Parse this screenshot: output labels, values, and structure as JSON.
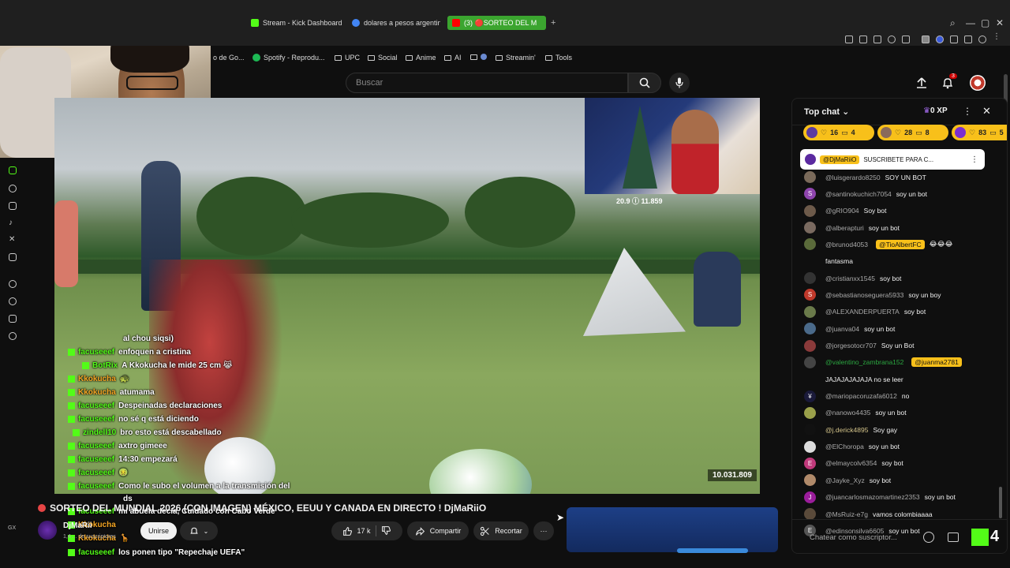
{
  "browser": {
    "tabs": [
      {
        "label": "Stream - Kick Dashboard",
        "icon": "kick-icon",
        "color": "#53fc18"
      },
      {
        "label": "dolares a pesos argentino",
        "icon": "google-icon",
        "color": "#4285f4"
      },
      {
        "label": "(3) 🔴SORTEO DEL M",
        "icon": "youtube-icon",
        "color": "#ff0000"
      }
    ],
    "new_tab": "+",
    "window_controls": [
      "—",
      "▢",
      "✕"
    ]
  },
  "bookmarks": [
    {
      "label": "o de Go..."
    },
    {
      "label": "Spotify - Reprodu..."
    },
    {
      "label": "UPC"
    },
    {
      "label": "Social"
    },
    {
      "label": "Anime"
    },
    {
      "label": "AI"
    },
    {
      "label": ""
    },
    {
      "label": "Streamin'"
    },
    {
      "label": "Tools"
    }
  ],
  "youtube": {
    "search_placeholder": "Buscar",
    "notification_count": "3"
  },
  "video": {
    "viewer_overlay": "10.031.809",
    "overlay_stats": "20.9 ⓘ 11.859",
    "kick_chat": [
      {
        "user": "",
        "text": "al chou siqsi)"
      },
      {
        "user": "facuseeef",
        "text": "enfoquen a cristina"
      },
      {
        "user": "BotRix",
        "text": "A Kkokucha le mide 25 cm 😹"
      },
      {
        "user": "Kkokucha",
        "text": "🐢"
      },
      {
        "user": "Kkokucha",
        "text": "atumama"
      },
      {
        "user": "facuseeef",
        "text": "Despeinadas declaraciones"
      },
      {
        "user": "facuseeef",
        "text": "no sé q está diciendo"
      },
      {
        "user": "zindell10",
        "text": "bro esto está descabellado"
      },
      {
        "user": "facuseeef",
        "text": "axtro gimeee"
      },
      {
        "user": "facuseeef",
        "text": "14:30 empezará"
      },
      {
        "user": "facuseeef",
        "text": "🤢"
      },
      {
        "user": "facuseeef",
        "text": "Como le subo el volumen a la transmisión del"
      },
      {
        "user": "",
        "text": "ds"
      },
      {
        "user": "facuseeef",
        "text": "mi abuela decía, Cuidado con Cabo Verde"
      },
      {
        "user": "Kkokucha",
        "text": ""
      },
      {
        "user": "Kkokucha",
        "text": "🦒"
      },
      {
        "user": "facuseeef",
        "text": "los ponen tipo \"Repechaje UEFA\""
      }
    ]
  },
  "details": {
    "title": "SORTEO DEL MUNDIAL 2026 (CON IMAGEN) MÉXICO, EEUU Y CANADA EN DIRECTO ! DjMaRiiO",
    "channel_short": "DjMaRii",
    "subscribers": "1,4 ... de suscriptores",
    "join_label": "Unirse",
    "likes": "17 k",
    "share_label": "Compartir",
    "clip_label": "Recortar",
    "more_label": "···"
  },
  "chat": {
    "title": "Top chat",
    "xp": "0 XP",
    "tickers": [
      {
        "a": "16",
        "b": "4"
      },
      {
        "a": "28",
        "b": "8"
      },
      {
        "a": "83",
        "b": "5"
      }
    ],
    "pinned": {
      "user": "@DjMaRiiO",
      "text": "SUSCRIBETE PARA C..."
    },
    "messages": [
      {
        "user": "@luisgerardo8250",
        "text": "SOY UN BOT",
        "color": "#7a6a5a",
        "initial": ""
      },
      {
        "user": "@santinokuchich7054",
        "text": "soy un bot",
        "color": "#8e44ad",
        "initial": "S"
      },
      {
        "user": "@gRIO904",
        "text": "Soy bot",
        "color": "#6d5a4a",
        "initial": ""
      },
      {
        "user": "@alberapturi",
        "text": "soy un bot",
        "color": "#7a6a60",
        "initial": ""
      },
      {
        "user": "@brunod4053",
        "text": "😂😂😂",
        "mention": "@TioAlbertFC",
        "color": "#5a6a3a",
        "initial": ""
      },
      {
        "user": "",
        "text": "fantasma",
        "color": "",
        "initial": ""
      },
      {
        "user": "@cristianxx1545",
        "text": "soy bot",
        "color": "#333",
        "initial": ""
      },
      {
        "user": "@sebastianoseguera5933",
        "text": "soy un boy",
        "color": "#c0392b",
        "initial": "S"
      },
      {
        "user": "@ALEXANDERPUERTA",
        "text": "soy bot",
        "color": "#6a7a4a",
        "initial": ""
      },
      {
        "user": "@juanva04",
        "text": "soy un bot",
        "color": "#4a6a8a",
        "initial": ""
      },
      {
        "user": "@jorgesotocr707",
        "text": "Soy un Bot",
        "color": "#8a3a3a",
        "initial": ""
      },
      {
        "user": "@valentino_zambrana152",
        "text": "",
        "mention": "@juanma2781",
        "color": "#444",
        "initial": "",
        "user_color": "#2ba640"
      },
      {
        "user": "",
        "text": "JAJAJAJAJAJA no se leer",
        "color": "",
        "initial": ""
      },
      {
        "user": "@mariopacoruzafa6012",
        "text": "no",
        "color": "#1a1a3a",
        "initial": "¥"
      },
      {
        "user": "@nanowo4435",
        "text": "soy un bot",
        "color": "#9aa04a",
        "initial": ""
      },
      {
        "user": "@j.derick4895",
        "text": "Soy gay",
        "color": "#111",
        "initial": "",
        "user_color": "#d4c48a"
      },
      {
        "user": "@ElChoropa",
        "text": "soy un bot",
        "color": "#ddd",
        "initial": ""
      },
      {
        "user": "@elmaycolv6354",
        "text": "soy bot",
        "color": "#c0397b",
        "initial": "E"
      },
      {
        "user": "@Jayke_Xyz",
        "text": "soy bot",
        "color": "#b08a6a",
        "initial": ""
      },
      {
        "user": "@juancarlosmazomartinez2353",
        "text": "soy un bot",
        "color": "#9b1d9b",
        "initial": "J"
      },
      {
        "user": "@MsRuiz-e7g",
        "text": "vamos colombiaaaa",
        "color": "#5a4a3a",
        "initial": ""
      },
      {
        "user": "@edinsonsilva6605",
        "text": "soy un bot",
        "color": "#555",
        "initial": "E"
      }
    ],
    "input_placeholder": "Chatear como suscriptor...",
    "kick_badge": "4"
  }
}
